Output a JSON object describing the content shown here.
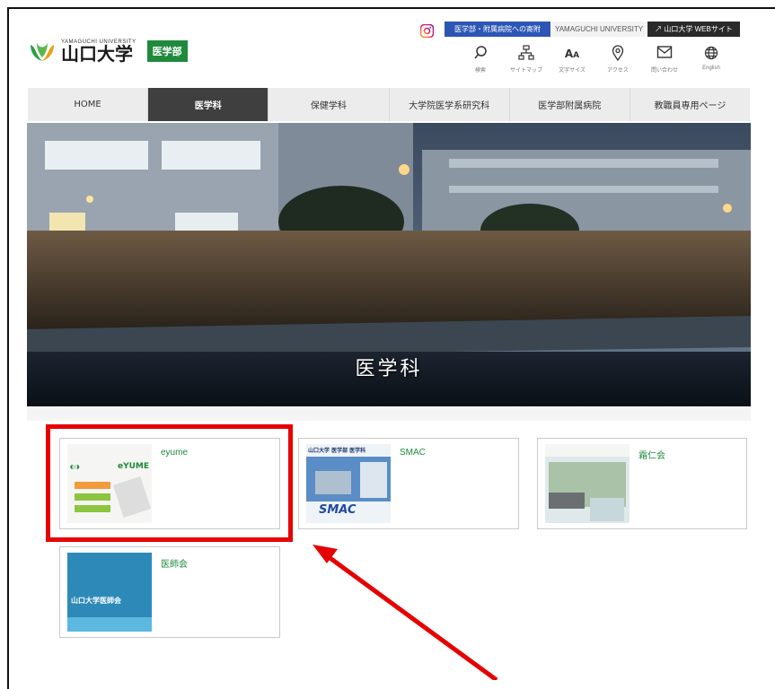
{
  "header": {
    "logo_en": "YAMAGUCHI UNIVERSITY",
    "logo_jp": "山口大学",
    "faculty_badge": "医学部",
    "donate_button": "医学部・附属病院への寄附",
    "university_name": "YAMAGUCHI UNIVERSITY",
    "website_button": "山口大学 WEBサイト",
    "utilities": [
      {
        "label": "検索",
        "icon": "search-icon"
      },
      {
        "label": "サイトマップ",
        "icon": "sitemap-icon"
      },
      {
        "label": "文字サイズ",
        "icon": "text-size-icon"
      },
      {
        "label": "アクセス",
        "icon": "location-icon"
      },
      {
        "label": "問い合わせ",
        "icon": "mail-icon"
      },
      {
        "label": "English",
        "icon": "globe-icon"
      }
    ]
  },
  "nav": {
    "items": [
      "HOME",
      "医学科",
      "保健学科",
      "大学院医学系研究科",
      "医学部附属病院",
      "教職員専用ページ"
    ],
    "active": "医学科"
  },
  "hero": {
    "title": "医学科"
  },
  "cards": [
    {
      "title": "eyume",
      "thumb_text": "eYUME"
    },
    {
      "title": "SMAC",
      "thumb_header": "山口大学 医学部 医学科",
      "thumb_text": "SMAC"
    },
    {
      "title": "霜仁会"
    },
    {
      "title": "医師会",
      "thumb_text": "山口大学医師会"
    }
  ],
  "colors": {
    "brand_green": "#1f8a3c",
    "donate_blue": "#2c56b5",
    "highlight_red": "#e60000"
  }
}
